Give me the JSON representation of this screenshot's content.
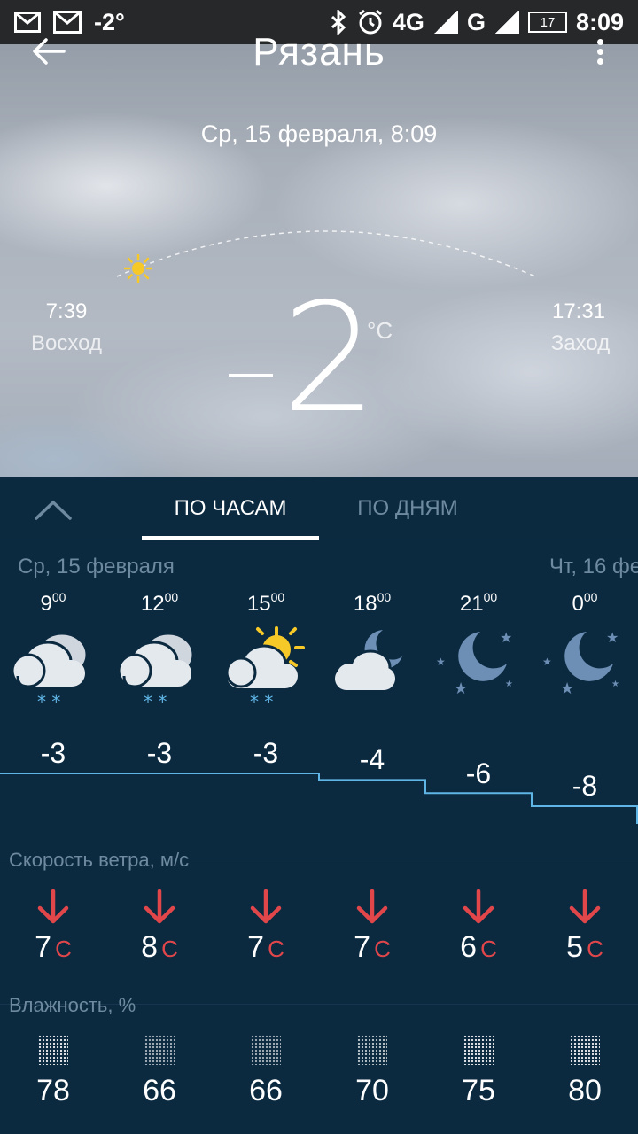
{
  "status_bar": {
    "temp": "-2°",
    "network_1": "4G",
    "network_1_small": "4G",
    "network_2": "G",
    "battery": "17",
    "time": "8:09"
  },
  "header": {
    "city": "Рязань",
    "date": "Ср, 15 февраля, 8:09"
  },
  "sun": {
    "rise_time": "7:39",
    "rise_label": "Восход",
    "set_time": "17:31",
    "set_label": "Заход"
  },
  "current": {
    "temperature": "2",
    "unit": "°C"
  },
  "tabs": {
    "hourly": "ПО ЧАСАМ",
    "daily": "ПО ДНЯМ"
  },
  "days": {
    "today": "Ср, 15 февраля",
    "tomorrow": "Чт, 16 фе"
  },
  "hours": [
    {
      "h": "9",
      "m": "00",
      "temp": "-3",
      "temp_value": -3,
      "icon": "cloudy-snow-icon",
      "wind": "7",
      "wind_dir": "С",
      "humidity": "78"
    },
    {
      "h": "12",
      "m": "00",
      "temp": "-3",
      "temp_value": -3,
      "icon": "cloudy-snow-icon",
      "wind": "8",
      "wind_dir": "С",
      "humidity": "66"
    },
    {
      "h": "15",
      "m": "00",
      "temp": "-3",
      "temp_value": -3,
      "icon": "partly-sunny-snow-icon",
      "wind": "7",
      "wind_dir": "С",
      "humidity": "66"
    },
    {
      "h": "18",
      "m": "00",
      "temp": "-4",
      "temp_value": -4,
      "icon": "cloudy-night-icon",
      "wind": "7",
      "wind_dir": "С",
      "humidity": "70"
    },
    {
      "h": "21",
      "m": "00",
      "temp": "-6",
      "temp_value": -6,
      "icon": "clear-night-icon",
      "wind": "6",
      "wind_dir": "С",
      "humidity": "75"
    },
    {
      "h": "0",
      "m": "00",
      "temp": "-8",
      "temp_value": -8,
      "icon": "clear-night-icon",
      "wind": "5",
      "wind_dir": "С",
      "humidity": "80"
    }
  ],
  "sections": {
    "wind_title": "Скорость ветра, м/с",
    "humidity_title": "Влажность, %"
  },
  "colors": {
    "panel_bg": "#0b2a40",
    "temp_line": "#5fb6e6",
    "wind_arrow": "#e0464a",
    "muted_text": "#6e8aa0"
  }
}
